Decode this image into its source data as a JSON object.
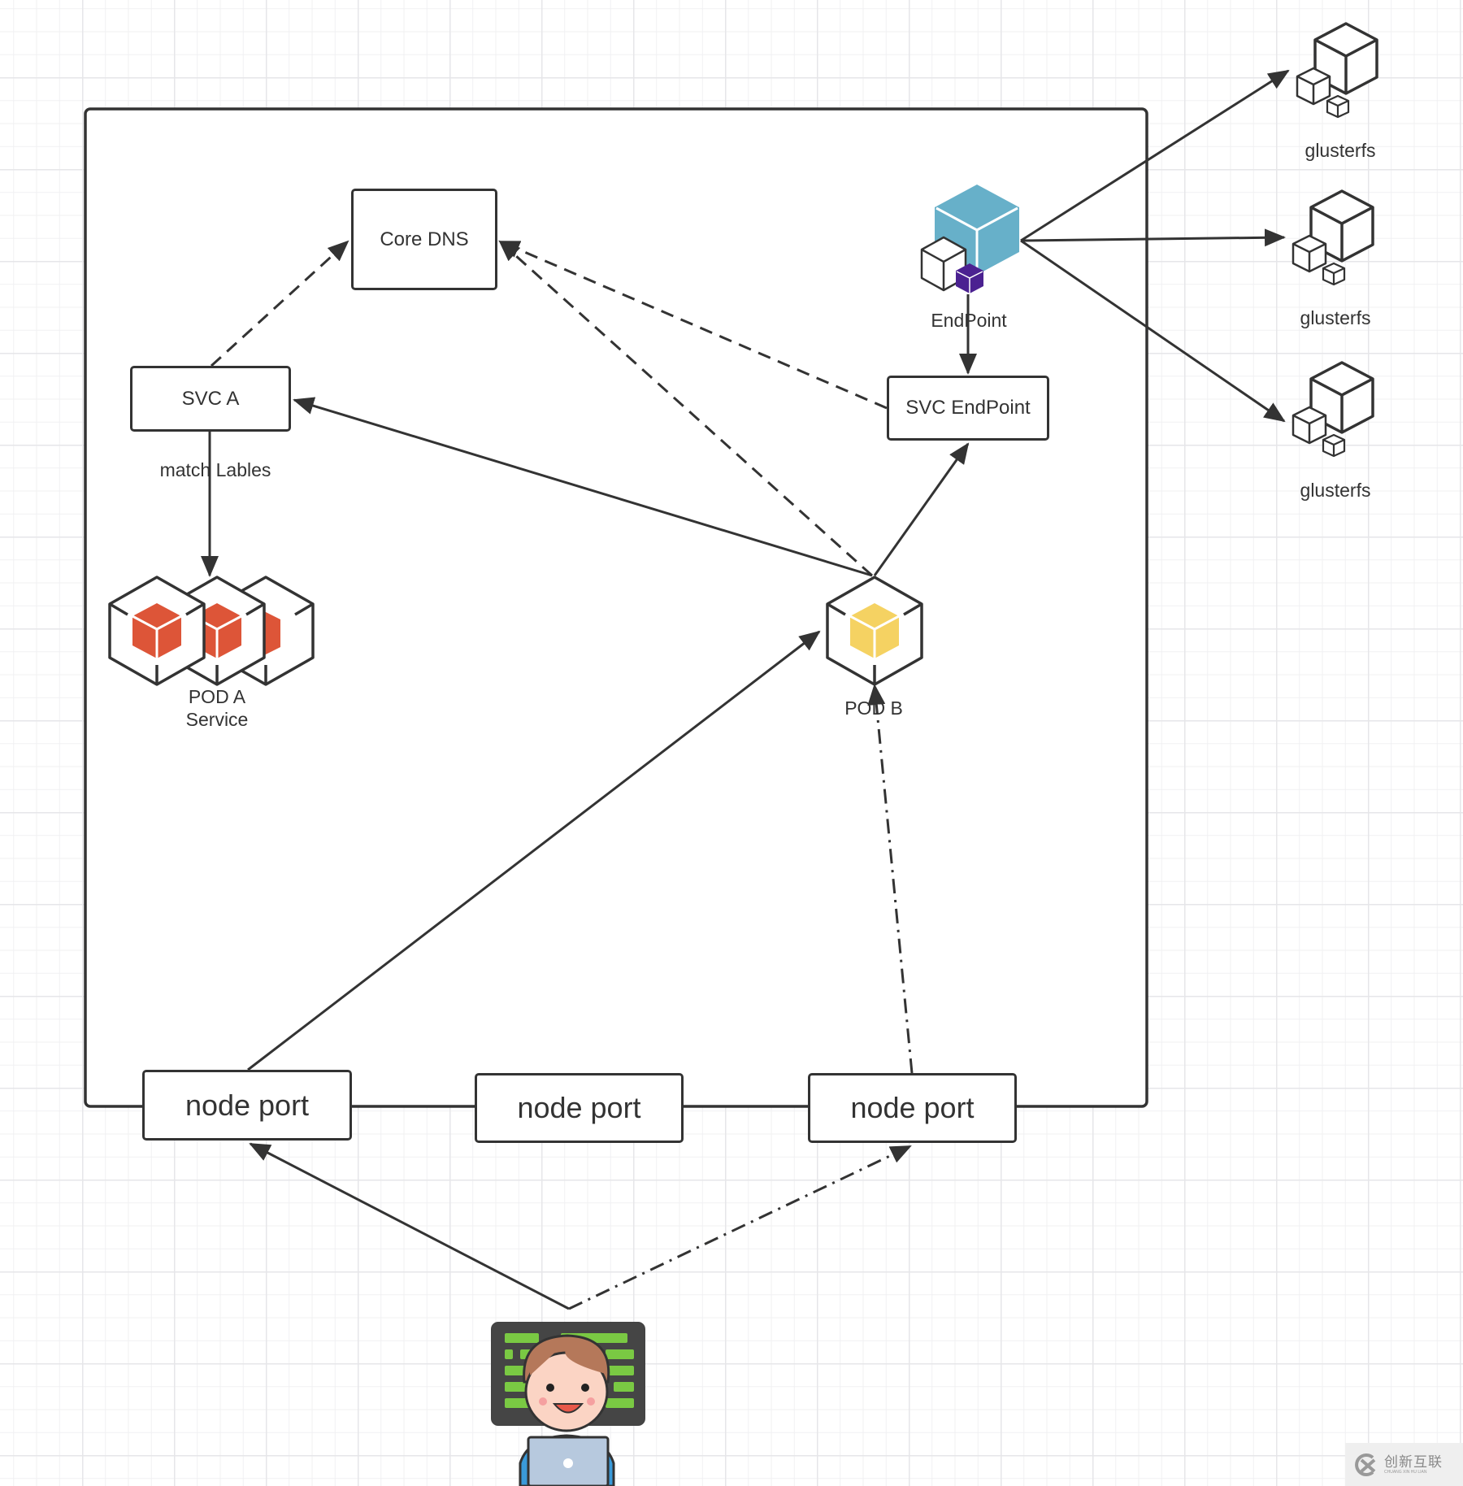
{
  "diagram": {
    "nodes": {
      "core_dns": "Core DNS",
      "svc_a": "SVC A",
      "svc_endpoint": "SVC EndPoint",
      "endpoint": "EndPoint",
      "pod_a_line1": "POD A",
      "pod_a_line2": "Service",
      "pod_b": "POD B",
      "node_port_1": "node port",
      "node_port_2": "node port",
      "node_port_3": "node port",
      "glusterfs_1": "glusterfs",
      "glusterfs_2": "glusterfs",
      "glusterfs_3": "glusterfs"
    },
    "edge_labels": {
      "svc_a_to_pod_a": "match Lables"
    },
    "edges": [
      {
        "from": "svc_a",
        "to": "core_dns",
        "style": "dashed"
      },
      {
        "from": "pod_b",
        "to": "core_dns",
        "style": "dashed"
      },
      {
        "from": "svc_endpoint",
        "to": "core_dns",
        "style": "dashed"
      },
      {
        "from": "svc_a",
        "to": "pod_a",
        "style": "solid",
        "label": "match Lables"
      },
      {
        "from": "pod_b",
        "to": "svc_a",
        "style": "solid"
      },
      {
        "from": "pod_b",
        "to": "svc_endpoint",
        "style": "solid"
      },
      {
        "from": "endpoint",
        "to": "svc_endpoint",
        "style": "solid"
      },
      {
        "from": "endpoint",
        "to": "glusterfs_1",
        "style": "solid"
      },
      {
        "from": "endpoint",
        "to": "glusterfs_2",
        "style": "solid"
      },
      {
        "from": "endpoint",
        "to": "glusterfs_3",
        "style": "solid"
      },
      {
        "from": "node_port_1",
        "to": "pod_b",
        "style": "solid"
      },
      {
        "from": "node_port_3",
        "to": "pod_b",
        "style": "dash-dot"
      },
      {
        "from": "user",
        "to": "node_port_1",
        "style": "solid"
      },
      {
        "from": "user",
        "to": "node_port_3",
        "style": "dash-dot"
      }
    ],
    "colors": {
      "stroke": "#333333",
      "endpoint_cube": "#67b0c9",
      "endpoint_small_cube": "#4b2191",
      "pod_a_cube": "#dd5538",
      "pod_b_cube": "#f5d262",
      "user_screen_lines": "#7ac943"
    }
  },
  "watermark": {
    "title": "创新互联",
    "subtitle": "CHUANG XIN HU LIAN"
  }
}
